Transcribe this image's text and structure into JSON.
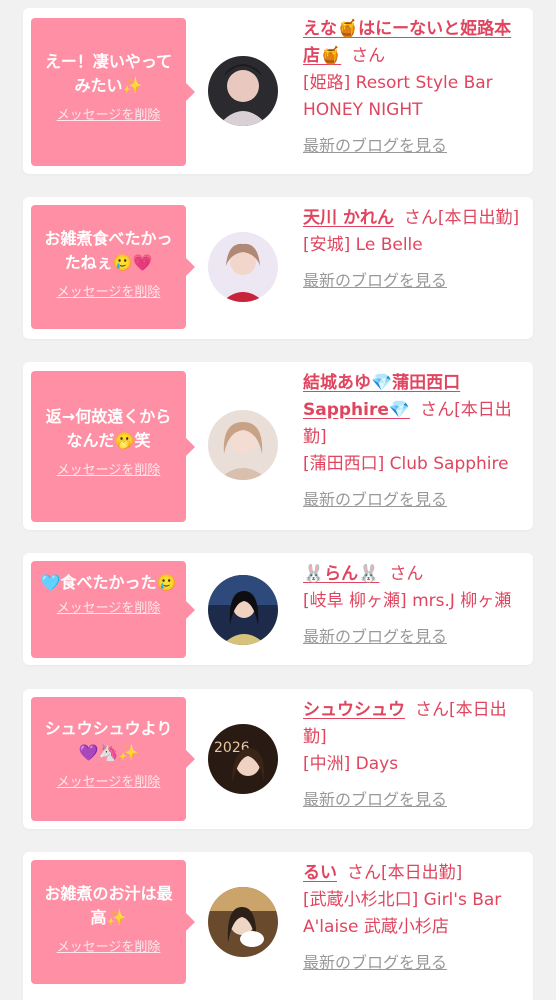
{
  "common": {
    "delete_label": "メッセージを削除",
    "blog_label": "最新のブログを見る",
    "san": "さん"
  },
  "cards": [
    {
      "message": "えー！凄いやってみたい✨",
      "name": "えな🍯はにーないと姫路本店🍯",
      "status": "",
      "store": "[姫路] Resort Style Bar HONEY NIGHT",
      "avatar_icon": "photo-avatar"
    },
    {
      "message": "お雑煮食べたかったねぇ🥲💗",
      "name": "天川 かれん",
      "status": "[本日出勤]",
      "store": "[安城] Le Belle",
      "avatar_icon": "photo-avatar"
    },
    {
      "message": "返→何故遠くからなんだ🫢笑",
      "name": "結城あゆ💎蒲田西口Sapphire💎",
      "status": "[本日出勤]",
      "store": "[蒲田西口] Club Sapphire",
      "avatar_icon": "photo-avatar"
    },
    {
      "message": "🩵食べたかった🥲",
      "name": "🐰らん🐰",
      "status": "",
      "store": "[岐阜 柳ヶ瀬] mrs.J 柳ヶ瀬",
      "avatar_icon": "photo-avatar"
    },
    {
      "message": "シュウシュウより💜🦄✨",
      "name": "シュウシュウ",
      "status": "[本日出勤]",
      "store": "[中洲] Days",
      "avatar_icon": "photo-avatar"
    },
    {
      "message": "お雑煮のお汁は最高✨",
      "name": "るい",
      "status": "[本日出勤]",
      "store": "[武蔵小杉北口] Girl's Bar A'laise 武蔵小杉店",
      "avatar_icon": "photo-avatar"
    }
  ],
  "colors": {
    "bubble": "#ff8fa5",
    "accent": "#e0455f",
    "muted": "#999999",
    "background": "#f1f1f1"
  }
}
